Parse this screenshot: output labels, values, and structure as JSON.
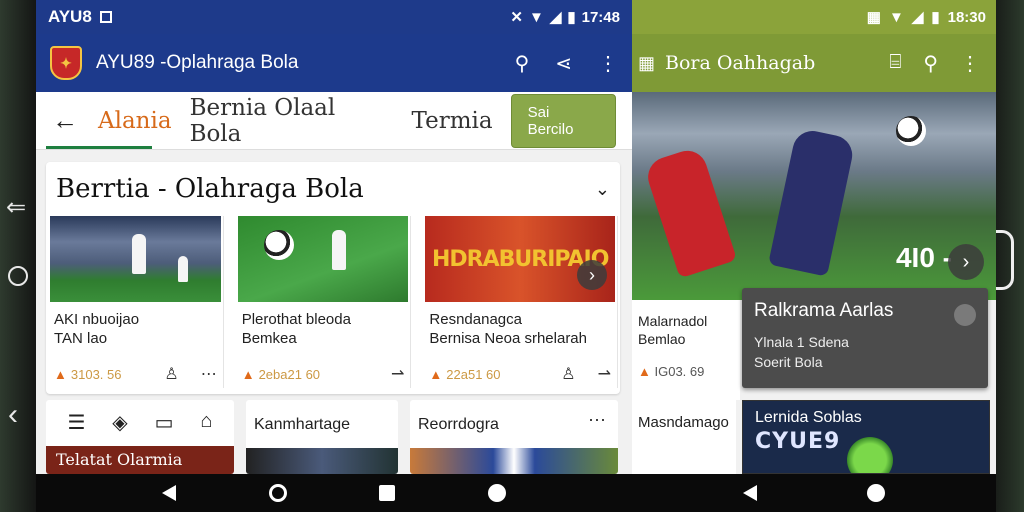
{
  "left_app": {
    "status": {
      "carrier": "AYU8",
      "time": "17:48"
    },
    "appbar": {
      "title": "AYU89 -Oplahraga Bola",
      "logo_icon": "club-crest-icon"
    },
    "tabs": [
      {
        "label": "Alania",
        "active": true
      },
      {
        "label": "Bernia Olaal Bola",
        "active": false
      },
      {
        "label": "Termia",
        "active": false
      }
    ],
    "cta_label": "Sai Bercilo",
    "section": {
      "title": "Berrtia - Olahraga Bola",
      "cards": [
        {
          "title": "AKI nbuoijao\nTAN lao",
          "meta": "3103. 56"
        },
        {
          "title": "Plerothat bleoda\nBemkea",
          "meta": "2eba21 60"
        },
        {
          "title": "Resndanagca\nBernisa Neoa srhelarah",
          "meta": "22a51 60",
          "banner": "HDRABURIPAIO"
        }
      ]
    },
    "row2": {
      "c1_label": "Telatat Olarmia",
      "c2_label": "Kanmhartage",
      "c3_label": "Reorrdogra"
    }
  },
  "right_app": {
    "status": {
      "time": "18:30"
    },
    "appbar": {
      "title": "Bora Oahhagab"
    },
    "hero": {
      "score": "4I0 -"
    },
    "card": {
      "title": "Malarnadol\nBemlao",
      "meta": "IG03. 69"
    },
    "overlay": {
      "title": "Ralkrama Aarlas",
      "line1": "Ylnala 1 Sdena",
      "line2": "Soerit Bola"
    },
    "row2": {
      "left_label": "Masndamago",
      "right_label": "Lernida Soblas",
      "right_big": "CYUE9"
    }
  },
  "colors": {
    "left_primary": "#1d3a8c",
    "right_primary": "#7f9a36",
    "tab_active": "#d76a1a",
    "cta": "#8aa84a",
    "overlay": "#4c4c4c"
  }
}
